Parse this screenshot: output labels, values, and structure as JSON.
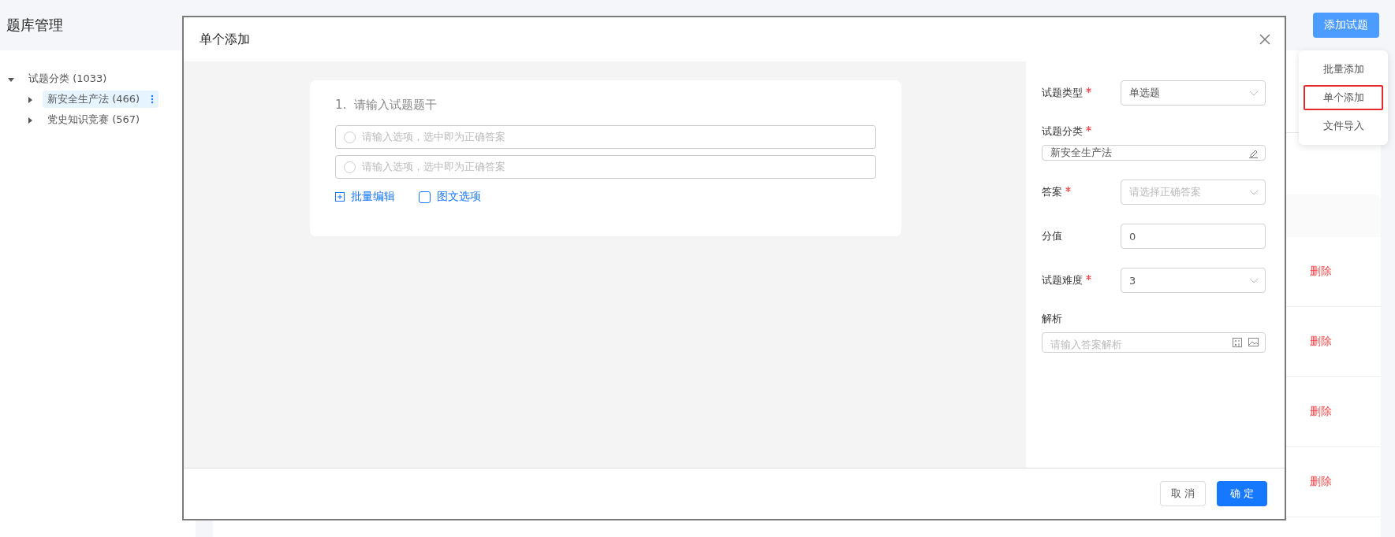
{
  "page": {
    "title": "题库管理"
  },
  "tree": [
    {
      "label": "试题分类 (1033)",
      "expanded": true,
      "selected": false,
      "children": [
        {
          "label": "新安全生产法 (466)",
          "expanded": false,
          "selected": true
        },
        {
          "label": "党史知识竞赛 (567)",
          "expanded": false,
          "selected": false
        }
      ]
    }
  ],
  "add_button": "添加试题",
  "add_menu": [
    {
      "label": "批量添加",
      "selected": false
    },
    {
      "label": "单个添加",
      "selected": true
    },
    {
      "label": "文件导入",
      "selected": false
    }
  ],
  "table": {
    "rows": [
      {
        "action": "删除"
      },
      {
        "action": "删除"
      },
      {
        "action": "删除"
      },
      {
        "action": "删除"
      }
    ]
  },
  "dialog": {
    "title": "单个添加",
    "question": {
      "number": "1.",
      "placeholder": "请输入试题题干",
      "options": [
        {
          "placeholder": "请输入选项，选中即为正确答案",
          "checked": false
        },
        {
          "placeholder": "请输入选项，选中即为正确答案",
          "checked": false
        }
      ],
      "batch_edit": "批量编辑",
      "image_option": {
        "label": "图文选项",
        "checked": false
      }
    },
    "form": [
      {
        "kind": "select",
        "label": "试题类型",
        "required": true,
        "value": "单选题"
      },
      {
        "kind": "picker",
        "label": "试题分类",
        "required": true,
        "value": "新安全生产法"
      },
      {
        "kind": "select",
        "label": "答案",
        "required": true,
        "placeholder": "请选择正确答案"
      },
      {
        "kind": "input",
        "label": "分值",
        "required": false,
        "value": "0"
      },
      {
        "kind": "select",
        "label": "试题难度",
        "required": true,
        "value": "3"
      },
      {
        "kind": "textarea",
        "label": "解析",
        "required": false,
        "placeholder": "请输入答案解析"
      }
    ],
    "buttons": {
      "cancel": "取 消",
      "ok": "确 定"
    }
  }
}
